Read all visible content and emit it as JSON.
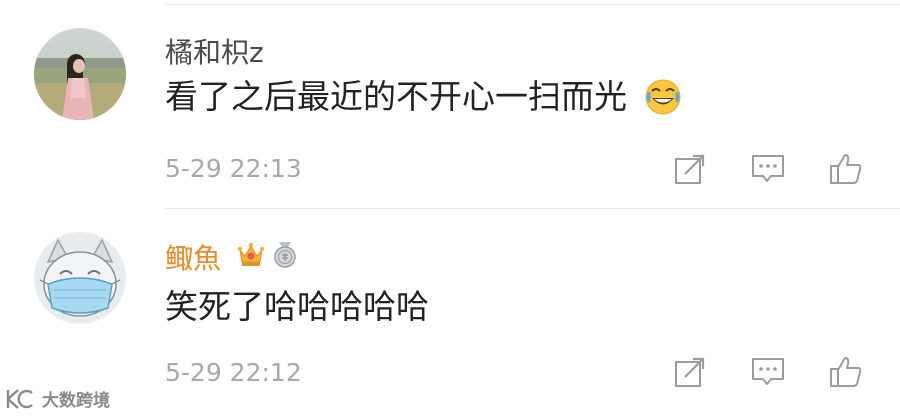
{
  "comments": [
    {
      "username": "橘和枳z",
      "text": "看了之后最近的不开心一扫而光",
      "emoji": "laughing-tears-emoji",
      "timestamp": "5-29 22:13",
      "avatar": "avatar-girl-photo"
    },
    {
      "username": "鲰魚",
      "text": "笑死了哈哈哈哈哈",
      "timestamp": "5-29 22:12",
      "avatar": "avatar-cat-mask",
      "badges": [
        "crown-vip-badge",
        "medal-badge"
      ],
      "username_color": "#e98b2a"
    }
  ],
  "actions": [
    "share-icon",
    "reply-icon",
    "like-icon"
  ],
  "watermark": {
    "text": "大数跨境",
    "logo": "k-logo-icon"
  }
}
